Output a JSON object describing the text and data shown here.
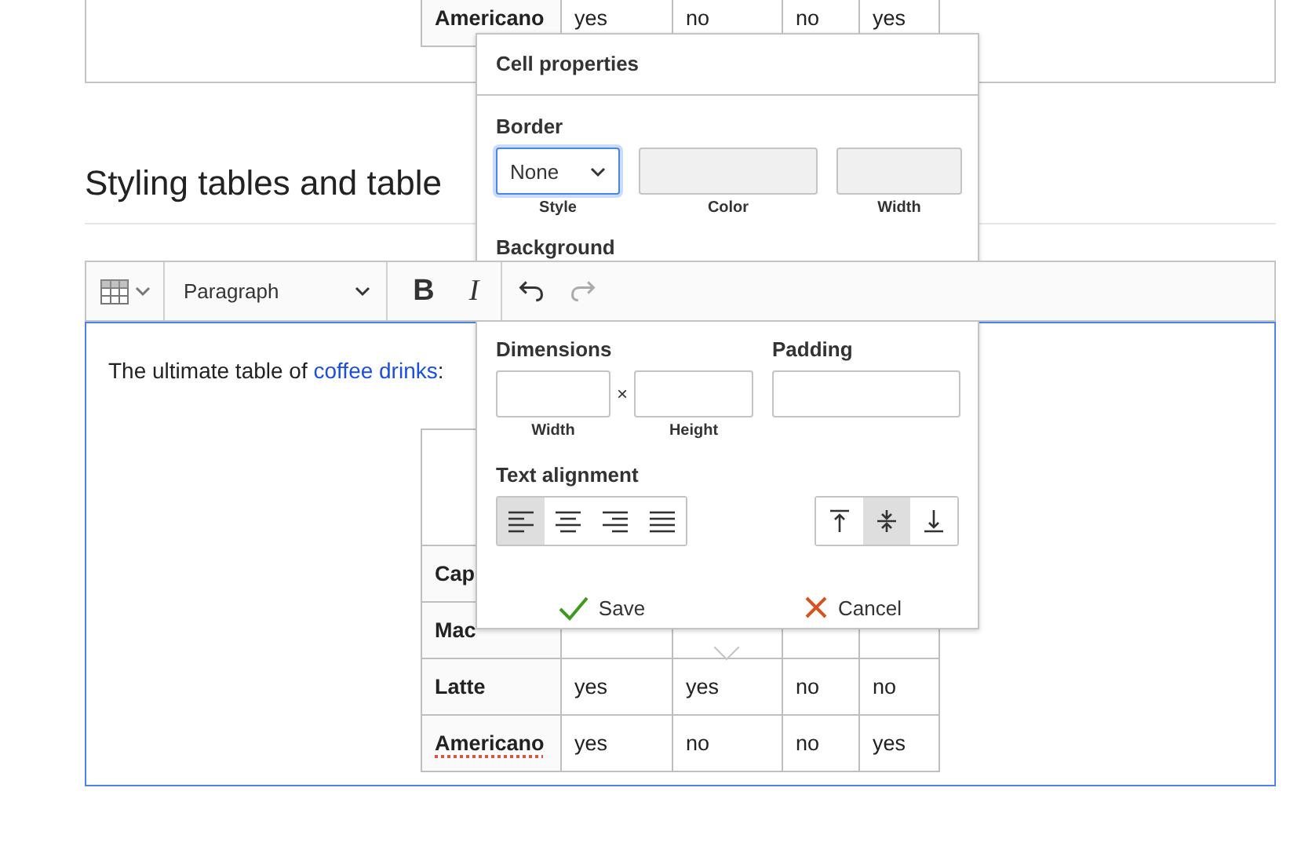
{
  "previous_table": {
    "rows": [
      {
        "cells": [
          "Americano",
          "yes",
          "no",
          "no",
          "yes"
        ]
      }
    ]
  },
  "heading": "Styling tables and table",
  "toolbar": {
    "items": [
      {
        "kind": "table"
      },
      {
        "kind": "heading",
        "label": "Paragraph"
      },
      {
        "kind": "bold",
        "label": "B"
      },
      {
        "kind": "italic",
        "label": "I"
      },
      {
        "kind": "undo",
        "disabled": false
      },
      {
        "kind": "redo",
        "disabled": true
      }
    ]
  },
  "editor": {
    "paragraph": {
      "text": "The ultimate table of ",
      "link": "coffee drinks",
      "after": ":"
    },
    "table": {
      "rows": [
        {
          "kind": "header"
        },
        {
          "kind": "body",
          "cells": [
            "Cap"
          ],
          "misspelled": false
        },
        {
          "kind": "body",
          "cells": [
            "Mac"
          ],
          "misspelled": false
        },
        {
          "kind": "body",
          "cells": [
            "Latte",
            "yes",
            "yes",
            "no",
            "no"
          ],
          "misspelled": false
        },
        {
          "kind": "body",
          "cells": [
            "Americano",
            "yes",
            "no",
            "no",
            "yes"
          ],
          "misspelled": true
        }
      ]
    }
  },
  "cell_properties": {
    "title": "Cell properties",
    "border": {
      "label": "Border",
      "style": {
        "value": "None",
        "caption": "Style"
      },
      "color": {
        "caption": "Color",
        "disabled": true
      },
      "width": {
        "caption": "Width",
        "disabled": true
      }
    },
    "background": {
      "label": "Background"
    },
    "dimensions": {
      "label": "Dimensions",
      "separator": "×",
      "width_caption": "Width",
      "height_caption": "Height"
    },
    "padding": {
      "label": "Padding"
    },
    "text_alignment": {
      "label": "Text alignment",
      "horizontal": [
        {
          "kind": "left",
          "selected": true
        },
        {
          "kind": "center",
          "selected": false
        },
        {
          "kind": "right",
          "selected": false
        },
        {
          "kind": "justify",
          "selected": false
        }
      ],
      "vertical": [
        {
          "kind": "top",
          "selected": false
        },
        {
          "kind": "middle",
          "selected": true
        },
        {
          "kind": "bottom",
          "selected": false
        }
      ]
    },
    "buttons": [
      {
        "kind": "save",
        "label": "Save"
      },
      {
        "kind": "cancel",
        "label": "Cancel"
      }
    ]
  }
}
